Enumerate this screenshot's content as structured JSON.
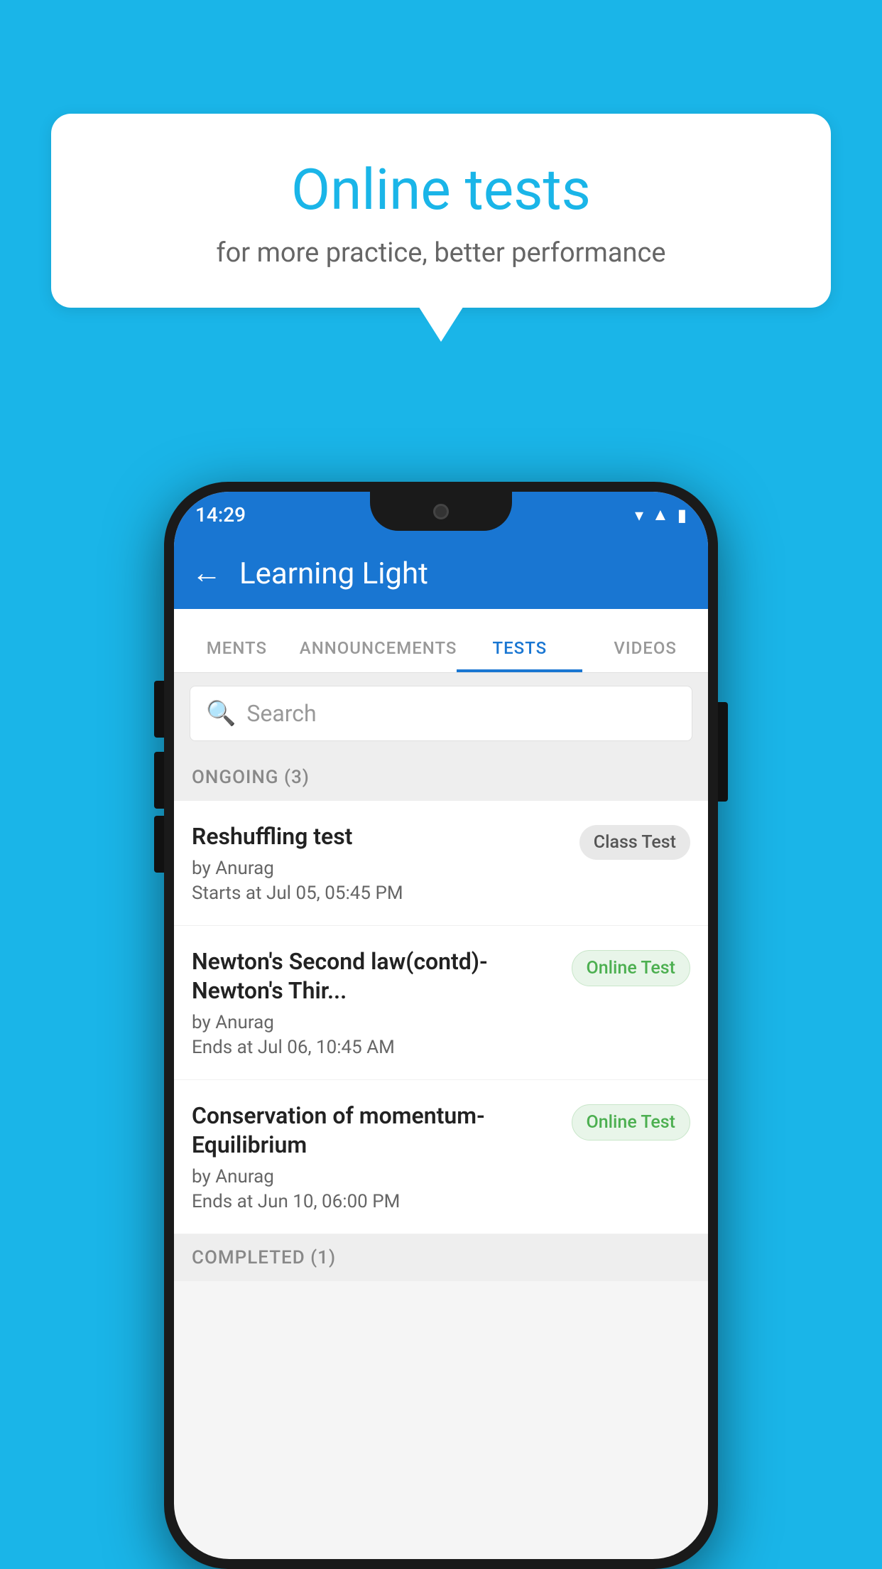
{
  "background_color": "#1ab5e8",
  "speech_bubble": {
    "title": "Online tests",
    "subtitle": "for more practice, better performance"
  },
  "phone": {
    "status_bar": {
      "time": "14:29",
      "icons": [
        "wifi",
        "signal",
        "battery"
      ]
    },
    "app_bar": {
      "title": "Learning Light",
      "back_label": "←"
    },
    "tabs": [
      {
        "label": "MENTS",
        "active": false
      },
      {
        "label": "ANNOUNCEMENTS",
        "active": false
      },
      {
        "label": "TESTS",
        "active": true
      },
      {
        "label": "VIDEOS",
        "active": false
      }
    ],
    "search": {
      "placeholder": "Search"
    },
    "sections": [
      {
        "header": "ONGOING (3)",
        "items": [
          {
            "name": "Reshuffling test",
            "by": "by Anurag",
            "date": "Starts at  Jul 05, 05:45 PM",
            "badge": "Class Test",
            "badge_type": "class"
          },
          {
            "name": "Newton's Second law(contd)-Newton's Thir...",
            "by": "by Anurag",
            "date": "Ends at  Jul 06, 10:45 AM",
            "badge": "Online Test",
            "badge_type": "online"
          },
          {
            "name": "Conservation of momentum-Equilibrium",
            "by": "by Anurag",
            "date": "Ends at  Jun 10, 06:00 PM",
            "badge": "Online Test",
            "badge_type": "online"
          }
        ]
      }
    ],
    "completed_header": "COMPLETED (1)"
  }
}
